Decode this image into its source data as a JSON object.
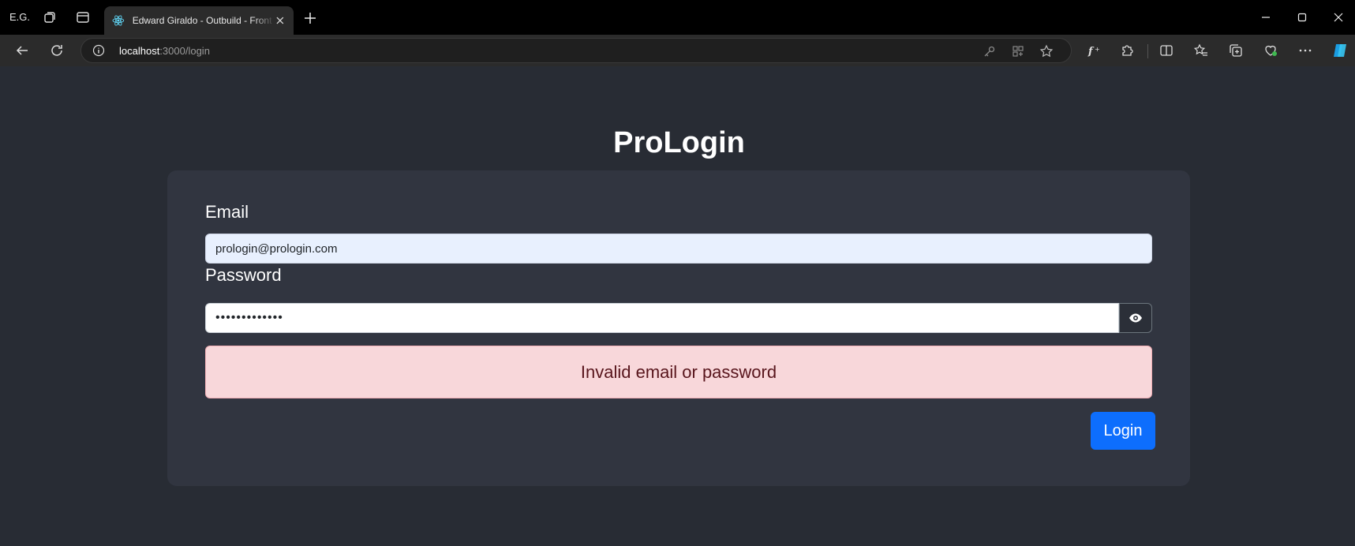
{
  "browser": {
    "profile_label": "E.G.",
    "tab_title": "Edward Giraldo - Outbuild - Front",
    "url_host": "localhost",
    "url_rest": ":3000/login"
  },
  "page": {
    "app_title": "ProLogin",
    "email_label": "Email",
    "email_value": "prologin@prologin.com",
    "password_label": "Password",
    "password_value": "•••••••••••••",
    "error_message": "Invalid email or password",
    "login_button": "Login"
  },
  "colors": {
    "background": "#282c34",
    "card": "#313540",
    "primary": "#0d6efd",
    "alert_bg": "#f8d7da",
    "alert_text": "#58151c"
  },
  "icons": {
    "toolbar": [
      "back-icon",
      "refresh-icon",
      "info-icon",
      "key-icon",
      "app-icon",
      "favorite-star-icon",
      "font-icon",
      "extensions-icon",
      "split-screen-icon",
      "favorites-icon",
      "collections-icon",
      "browser-essentials-icon",
      "more-icon",
      "copilot-icon"
    ],
    "field": [
      "eye-icon"
    ]
  }
}
